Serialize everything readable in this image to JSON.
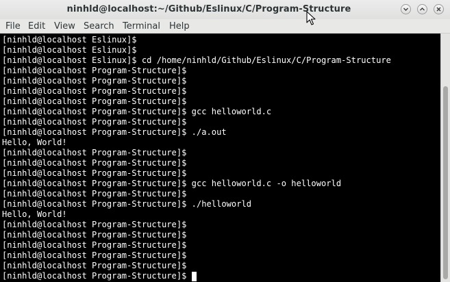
{
  "window": {
    "title": "ninhld@localhost:~/Github/Eslinux/C/Program-Structure",
    "controls": {
      "minimize_icon": "chevron-down-icon",
      "maximize_icon": "chevron-up-icon",
      "close_icon": "close-icon"
    }
  },
  "menubar": {
    "items": [
      {
        "label": "File"
      },
      {
        "label": "Edit"
      },
      {
        "label": "View"
      },
      {
        "label": "Search"
      },
      {
        "label": "Terminal"
      },
      {
        "label": "Help"
      }
    ]
  },
  "terminal": {
    "lines": [
      "[ninhld@localhost Eslinux]$",
      "[ninhld@localhost Eslinux]$",
      "[ninhld@localhost Eslinux]$ cd /home/ninhld/Github/Eslinux/C/Program-Structure",
      "[ninhld@localhost Program-Structure]$",
      "[ninhld@localhost Program-Structure]$",
      "[ninhld@localhost Program-Structure]$",
      "[ninhld@localhost Program-Structure]$",
      "[ninhld@localhost Program-Structure]$ gcc helloworld.c",
      "[ninhld@localhost Program-Structure]$",
      "[ninhld@localhost Program-Structure]$ ./a.out",
      "Hello, World!",
      "[ninhld@localhost Program-Structure]$",
      "[ninhld@localhost Program-Structure]$",
      "[ninhld@localhost Program-Structure]$",
      "[ninhld@localhost Program-Structure]$ gcc helloworld.c -o helloworld",
      "[ninhld@localhost Program-Structure]$",
      "[ninhld@localhost Program-Structure]$ ./helloworld",
      "Hello, World!",
      "[ninhld@localhost Program-Structure]$",
      "[ninhld@localhost Program-Structure]$",
      "[ninhld@localhost Program-Structure]$",
      "[ninhld@localhost Program-Structure]$",
      "[ninhld@localhost Program-Structure]$",
      "[ninhld@localhost Program-Structure]$ "
    ],
    "colors": {
      "background": "#000000",
      "foreground": "#ffffff"
    }
  }
}
